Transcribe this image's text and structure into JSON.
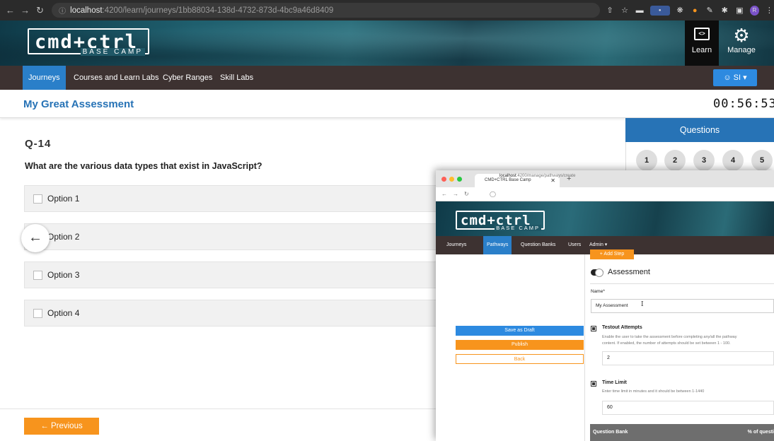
{
  "browser": {
    "url_host": "localhost",
    "url_rest": ":4200/learn/journeys/1bb88034-138d-4732-873d-4bc9a46d8409",
    "extensions": [
      "share-icon",
      "star-icon",
      "ext-icon-1",
      "ext-icon-2",
      "ext-icon-3",
      "ext-icon-4",
      "ext-icon-5",
      "puzzle-icon",
      "sidebar-icon",
      "profile-icon",
      "menu-icon"
    ]
  },
  "header": {
    "logo_text": "cmd+ctrl",
    "logo_sub": "BASE CAMP",
    "learn_label": "Learn",
    "manage_label": "Manage"
  },
  "nav": {
    "items": [
      "Journeys",
      "Courses and Learn Labs",
      "Cyber Ranges",
      "Skill Labs"
    ],
    "user_label": "SI"
  },
  "assessment": {
    "title": "My Great Assessment",
    "timer": "00:56:53",
    "question_number": "Q-14",
    "question_text": "What are the various data types that exist in JavaScript?",
    "options": [
      "Option 1",
      "Option 2",
      "Option 3",
      "Option 4"
    ],
    "previous_label": "← Previous"
  },
  "questions_panel": {
    "title": "Questions",
    "numbers": [
      "1",
      "2",
      "3",
      "4",
      "5"
    ]
  },
  "overlay": {
    "tab_title": "CMD+CTRL Base Camp",
    "url_host": "localhost",
    "url_rest": ":4200/manage/pathways/create",
    "logo_text": "cmd+ctrl",
    "logo_sub": "BASE CAMP",
    "nav": [
      "Journeys",
      "Pathways",
      "Question Banks",
      "Users",
      "Admin ▾"
    ],
    "add_step": "+ Add Step",
    "assessment_label": "Assessment",
    "name_label": "Name*",
    "name_value": "My Assessment",
    "testout_label": "Testout Attempts",
    "testout_desc_1": "Enable the user to take the assessment before completing any/all the pathway",
    "testout_desc_2": "content. If enabled, the number of attempts should be set between 1 - 100.",
    "attempts_value": "2",
    "time_limit_label": "Time Limit",
    "time_limit_desc": "Enter time limit in minutes and it should be between 1-1440",
    "time_limit_value": "60",
    "qbank_col": "Question Bank",
    "percent_col": "% of questi",
    "save_draft": "Save as Draft",
    "publish": "Publish",
    "back": "Back"
  },
  "colors": {
    "primary": "#2773b6",
    "orange": "#f7941d",
    "nav_bg": "#3d3231"
  }
}
